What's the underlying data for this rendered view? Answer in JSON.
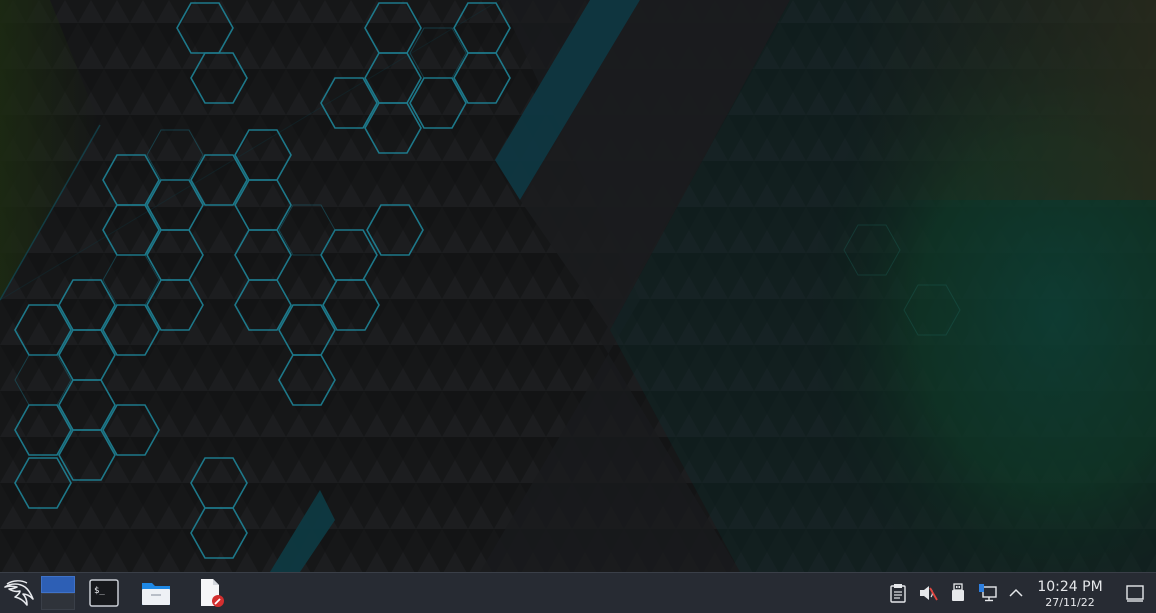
{
  "desktop": {
    "wallpaper": "kali-hexagon-dark",
    "colors": {
      "base": "#141516",
      "hex_outline": "#1f8a9e",
      "teal_band": "#0d3b44",
      "green_glow": "#163d1c",
      "orange_glow": "#3b2a12"
    }
  },
  "taskbar": {
    "background": "#272b33",
    "launcher": {
      "icon": "kali-dragon-icon"
    },
    "pager": {
      "desktops": [
        "Desktop 1",
        "Desktop 2"
      ],
      "active": 0
    },
    "tasks": [
      {
        "icon": "terminal-icon"
      },
      {
        "icon": "folder-icon"
      },
      {
        "icon": "text-editor-icon"
      }
    ],
    "tray": [
      {
        "icon": "clipboard-icon"
      },
      {
        "icon": "volume-muted-icon"
      },
      {
        "icon": "usb-drive-icon"
      },
      {
        "icon": "network-icon"
      },
      {
        "icon": "chevron-up-icon"
      }
    ],
    "clock": {
      "time": "10:24 PM",
      "date": "27/11/22"
    },
    "show_desktop": {
      "icon": "show-desktop-icon"
    }
  }
}
